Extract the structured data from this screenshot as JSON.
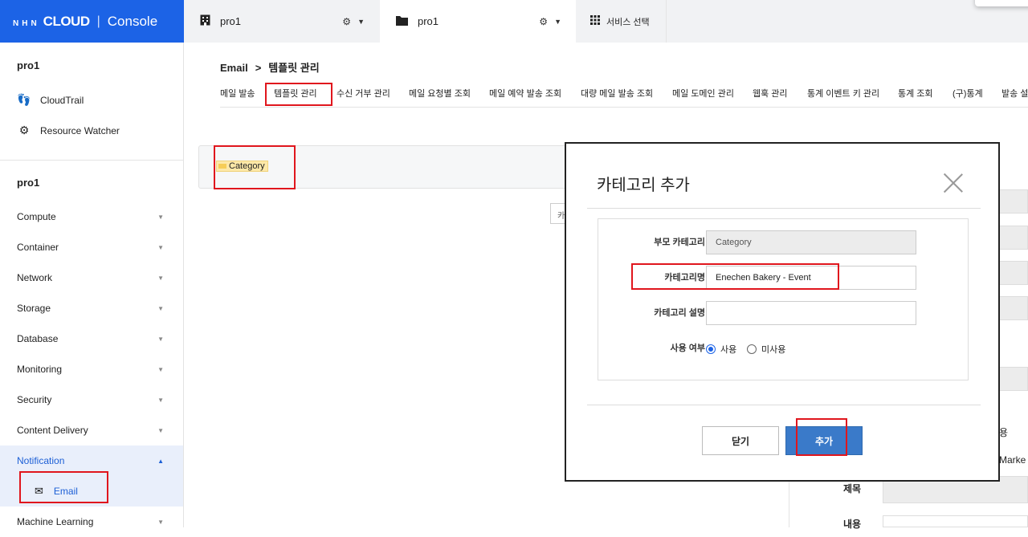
{
  "brand": {
    "logo_small": "NHN",
    "logo_big": "CLOUD",
    "separator": "|",
    "console": "Console"
  },
  "header": {
    "org_tab": {
      "name": "pro1",
      "icon": "building-icon"
    },
    "project_tab": {
      "name": "pro1",
      "icon": "folder-icon"
    },
    "service_select": "서비스 선택"
  },
  "sidebar": {
    "org_title": "pro1",
    "org_links": [
      {
        "label": "CloudTrail",
        "icon": "footprints-icon"
      },
      {
        "label": "Resource Watcher",
        "icon": "gear-eye-icon"
      }
    ],
    "project_title": "pro1",
    "items": [
      {
        "label": "Compute"
      },
      {
        "label": "Container"
      },
      {
        "label": "Network"
      },
      {
        "label": "Storage"
      },
      {
        "label": "Database"
      },
      {
        "label": "Monitoring"
      },
      {
        "label": "Security"
      },
      {
        "label": "Content Delivery"
      },
      {
        "label": "Notification"
      },
      {
        "label": "Machine Learning"
      }
    ],
    "sub_item": "Email"
  },
  "breadcrumb": {
    "service": "Email",
    "page": "템플릿 관리"
  },
  "tabs": [
    "메일 발송",
    "템플릿 관리",
    "수신 거부 관리",
    "메일 요청별 조회",
    "메일 예약 발송 조회",
    "대량 메일 발송 조회",
    "메일 도메인 관리",
    "웹훅 관리",
    "통계 이벤트 키 관리",
    "통계 조회",
    "(구)통계",
    "발송 설"
  ],
  "category_tree": {
    "root": "Category",
    "small_button": "카"
  },
  "background_form": {
    "r1": "용",
    "r2": "Marke",
    "subject_label": "제목",
    "content_label": "내용"
  },
  "modal": {
    "title": "카테고리 추가",
    "fields": {
      "parent_label": "부모 카테고리",
      "parent_value": "Category",
      "name_label": "카테고리명",
      "name_value": "Enechen Bakery - Event",
      "desc_label": "카테고리 설명",
      "desc_value": "",
      "use_label": "사용 여부",
      "use_yes": "사용",
      "use_no": "미사용",
      "use_selected": "사용"
    },
    "close_button": "닫기",
    "add_button": "추가"
  },
  "colors": {
    "brand_blue": "#1c63e6",
    "highlight_red": "#e0161d",
    "add_button": "#3a7ac9"
  }
}
